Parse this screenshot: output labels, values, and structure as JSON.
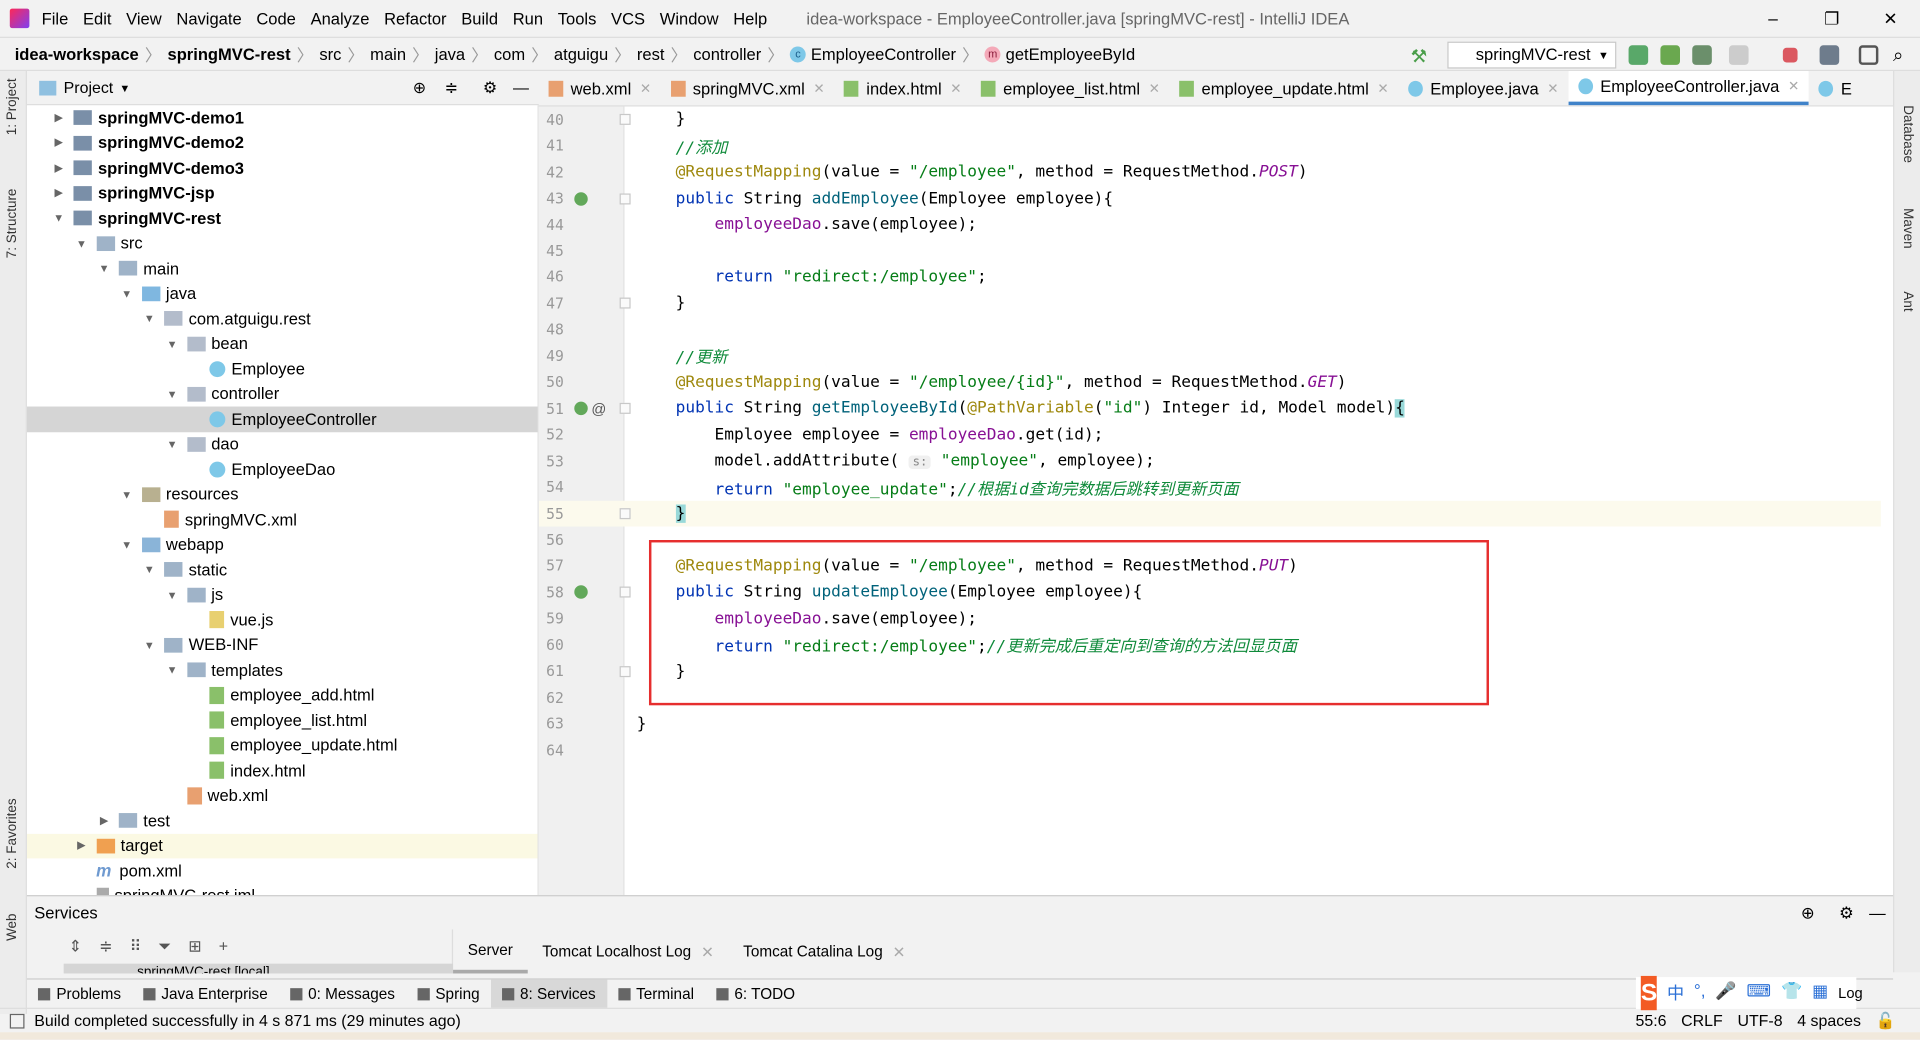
{
  "menu": {
    "items": [
      "File",
      "Edit",
      "View",
      "Navigate",
      "Code",
      "Analyze",
      "Refactor",
      "Build",
      "Run",
      "Tools",
      "VCS",
      "Window",
      "Help"
    ],
    "title": "idea-workspace - EmployeeController.java [springMVC-rest] - IntelliJ IDEA",
    "controls": [
      "–",
      "❐",
      "✕"
    ]
  },
  "breadcrumb": {
    "items": [
      "idea-workspace",
      "springMVC-rest",
      "src",
      "main",
      "java",
      "com",
      "atguigu",
      "rest",
      "controller",
      "EmployeeController",
      "getEmployeeById"
    ],
    "run_config": "springMVC-rest"
  },
  "left_strip": {
    "tabs": [
      "1: Project",
      "7: Structure",
      "2: Favorites",
      "Web"
    ]
  },
  "right_strip": {
    "tabs": [
      "Database",
      "Maven",
      "Ant"
    ]
  },
  "project": {
    "title": "Project",
    "tree": [
      {
        "d": 0,
        "a": "▶",
        "i": "mod",
        "b": true,
        "label": "springMVC-demo1"
      },
      {
        "d": 0,
        "a": "▶",
        "i": "mod",
        "b": true,
        "label": "springMVC-demo2"
      },
      {
        "d": 0,
        "a": "▶",
        "i": "mod",
        "b": true,
        "label": "springMVC-demo3"
      },
      {
        "d": 0,
        "a": "▶",
        "i": "mod",
        "b": true,
        "label": "springMVC-jsp"
      },
      {
        "d": 0,
        "a": "▼",
        "i": "mod",
        "b": true,
        "label": "springMVC-rest"
      },
      {
        "d": 1,
        "a": "▼",
        "i": "dir",
        "label": "src"
      },
      {
        "d": 2,
        "a": "▼",
        "i": "dir",
        "label": "main"
      },
      {
        "d": 3,
        "a": "▼",
        "i": "src",
        "label": "java"
      },
      {
        "d": 4,
        "a": "▼",
        "i": "pkg",
        "label": "com.atguigu.rest"
      },
      {
        "d": 5,
        "a": "▼",
        "i": "pkg",
        "label": "bean"
      },
      {
        "d": 6,
        "a": "",
        "i": "class",
        "label": "Employee"
      },
      {
        "d": 5,
        "a": "▼",
        "i": "pkg",
        "label": "controller"
      },
      {
        "d": 6,
        "a": "",
        "i": "class",
        "label": "EmployeeController",
        "sel": true
      },
      {
        "d": 5,
        "a": "▼",
        "i": "pkg",
        "label": "dao"
      },
      {
        "d": 6,
        "a": "",
        "i": "class",
        "label": "EmployeeDao"
      },
      {
        "d": 3,
        "a": "▼",
        "i": "res",
        "label": "resources"
      },
      {
        "d": 4,
        "a": "",
        "i": "xml",
        "label": "springMVC.xml"
      },
      {
        "d": 3,
        "a": "▼",
        "i": "web",
        "label": "webapp"
      },
      {
        "d": 4,
        "a": "▼",
        "i": "dir",
        "label": "static"
      },
      {
        "d": 5,
        "a": "▼",
        "i": "dir",
        "label": "js"
      },
      {
        "d": 6,
        "a": "",
        "i": "js",
        "label": "vue.js"
      },
      {
        "d": 4,
        "a": "▼",
        "i": "dir",
        "label": "WEB-INF"
      },
      {
        "d": 5,
        "a": "▼",
        "i": "dir",
        "label": "templates"
      },
      {
        "d": 6,
        "a": "",
        "i": "html",
        "label": "employee_add.html"
      },
      {
        "d": 6,
        "a": "",
        "i": "html",
        "label": "employee_list.html"
      },
      {
        "d": 6,
        "a": "",
        "i": "html",
        "label": "employee_update.html"
      },
      {
        "d": 6,
        "a": "",
        "i": "html",
        "label": "index.html"
      },
      {
        "d": 5,
        "a": "",
        "i": "xml",
        "label": "web.xml"
      },
      {
        "d": 2,
        "a": "▶",
        "i": "dir",
        "label": "test"
      },
      {
        "d": 1,
        "a": "▶",
        "i": "orange",
        "label": "target",
        "hl": true
      },
      {
        "d": 1,
        "a": "",
        "i": "mvn",
        "label": "pom.xml"
      },
      {
        "d": 1,
        "a": "",
        "i": "iml",
        "label": "springMVC-rest.iml"
      }
    ]
  },
  "editor_tabs": [
    {
      "label": "web.xml",
      "i": "xml"
    },
    {
      "label": "springMVC.xml",
      "i": "xml"
    },
    {
      "label": "index.html",
      "i": "html"
    },
    {
      "label": "employee_list.html",
      "i": "html"
    },
    {
      "label": "employee_update.html",
      "i": "html"
    },
    {
      "label": "Employee.java",
      "i": "class"
    },
    {
      "label": "EmployeeController.java",
      "i": "class",
      "active": true
    },
    {
      "label": "E",
      "i": "class"
    }
  ],
  "code": {
    "current_line": 55,
    "lines": [
      {
        "n": 40,
        "fold": true,
        "t": [
          [
            "",
            "    }"
          ]
        ]
      },
      {
        "n": 41,
        "t": [
          [
            "cmg",
            "    //添加"
          ]
        ]
      },
      {
        "n": 42,
        "t": [
          [
            "a",
            "    @RequestMapping"
          ],
          [
            "",
            "(value = "
          ],
          [
            "s",
            "\"/employee\""
          ],
          [
            "",
            ", method = RequestMethod."
          ],
          [
            "it",
            "POST"
          ],
          [
            "",
            ")"
          ]
        ]
      },
      {
        "n": 43,
        "g": true,
        "fold": true,
        "t": [
          [
            "k",
            "    public "
          ],
          [
            "",
            "String "
          ],
          [
            "fn",
            "addEmployee"
          ],
          [
            "",
            "(Employee employee){"
          ]
        ]
      },
      {
        "n": 44,
        "t": [
          [
            "fld",
            "        employeeDao"
          ],
          [
            "",
            ".save(employee);"
          ]
        ]
      },
      {
        "n": 45,
        "t": []
      },
      {
        "n": 46,
        "t": [
          [
            "k",
            "        return "
          ],
          [
            "s",
            "\"redirect:/employee\""
          ],
          [
            "",
            ";"
          ]
        ]
      },
      {
        "n": 47,
        "fold": true,
        "t": [
          [
            "",
            "    }"
          ]
        ]
      },
      {
        "n": 48,
        "t": []
      },
      {
        "n": 49,
        "t": [
          [
            "cmg",
            "    //更新"
          ]
        ]
      },
      {
        "n": 50,
        "t": [
          [
            "a",
            "    @RequestMapping"
          ],
          [
            "",
            "(value = "
          ],
          [
            "s",
            "\"/employee/{id}\""
          ],
          [
            "",
            ", method = RequestMethod."
          ],
          [
            "it",
            "GET"
          ],
          [
            "",
            ")"
          ]
        ]
      },
      {
        "n": 51,
        "g": true,
        "at": true,
        "fold": true,
        "t": [
          [
            "k",
            "    public "
          ],
          [
            "",
            "String "
          ],
          [
            "fn",
            "getEmployeeById"
          ],
          [
            "",
            "("
          ],
          [
            "a",
            "@PathVariable"
          ],
          [
            "",
            "("
          ],
          [
            "s",
            "\"id\""
          ],
          [
            "",
            ") Integer id, Model model)"
          ],
          [
            "br",
            "{"
          ]
        ]
      },
      {
        "n": 52,
        "t": [
          [
            "",
            "        Employee employee = "
          ],
          [
            "fld",
            "employeeDao"
          ],
          [
            "",
            ".get(id);"
          ]
        ]
      },
      {
        "n": 53,
        "t": [
          [
            "",
            "        model.addAttribute( "
          ],
          [
            "hint",
            "s:"
          ],
          [
            "s",
            " \"employee\""
          ],
          [
            "",
            ", employee);"
          ]
        ]
      },
      {
        "n": 54,
        "t": [
          [
            "k",
            "        return "
          ],
          [
            "s",
            "\"employee_update\""
          ],
          [
            "",
            ";"
          ],
          [
            "cmg",
            "//根据id查询完数据后跳转到更新页面"
          ]
        ]
      },
      {
        "n": 55,
        "fold": true,
        "t": [
          [
            "",
            "    "
          ],
          [
            "br",
            "}"
          ]
        ]
      },
      {
        "n": 56,
        "t": []
      },
      {
        "n": 57,
        "t": [
          [
            "a",
            "    @RequestMapping"
          ],
          [
            "",
            "(value = "
          ],
          [
            "s",
            "\"/employee\""
          ],
          [
            "",
            ", method = RequestMethod."
          ],
          [
            "it",
            "PUT"
          ],
          [
            "",
            ")"
          ]
        ]
      },
      {
        "n": 58,
        "g": true,
        "fold": true,
        "t": [
          [
            "k",
            "    public "
          ],
          [
            "",
            "String "
          ],
          [
            "fn",
            "updateEmployee"
          ],
          [
            "",
            "(Employee employee){"
          ]
        ]
      },
      {
        "n": 59,
        "t": [
          [
            "fld",
            "        employeeDao"
          ],
          [
            "",
            ".save(employee);"
          ]
        ]
      },
      {
        "n": 60,
        "t": [
          [
            "k",
            "        return "
          ],
          [
            "s",
            "\"redirect:/employee\""
          ],
          [
            "",
            ";"
          ],
          [
            "cmg",
            "//更新完成后重定向到查询的方法回显页面"
          ]
        ]
      },
      {
        "n": 61,
        "fold": true,
        "t": [
          [
            "",
            "    }"
          ]
        ]
      },
      {
        "n": 62,
        "t": []
      },
      {
        "n": 63,
        "t": [
          [
            "",
            "}"
          ]
        ]
      },
      {
        "n": 64,
        "t": []
      }
    ]
  },
  "services": {
    "title": "Services",
    "tabs": [
      "Server",
      "Tomcat Localhost Log",
      "Tomcat Catalina Log"
    ],
    "tree_item": "springMVC-rest [local]"
  },
  "tool_windows": [
    "Problems",
    "Java Enterprise",
    "0: Messages",
    "Spring",
    "8: Services",
    "Terminal",
    "6: TODO"
  ],
  "active_tool_window": "8: Services",
  "status": {
    "message": "Build completed successfully in 4 s 871 ms (29 minutes ago)",
    "position": "55:6",
    "line_sep": "CRLF",
    "encoding": "UTF-8",
    "indent": "4 spaces",
    "event_log": "Log"
  },
  "ime": {
    "brand": "S",
    "chars": [
      "中",
      "°,",
      "🎤",
      "⌨",
      "👕",
      "▦"
    ]
  },
  "colors": {
    "accent": "#4083c9",
    "highlight_box": "#e62e2e",
    "keyword": "#0033b3",
    "string": "#067d17",
    "annotation": "#9e880d"
  }
}
